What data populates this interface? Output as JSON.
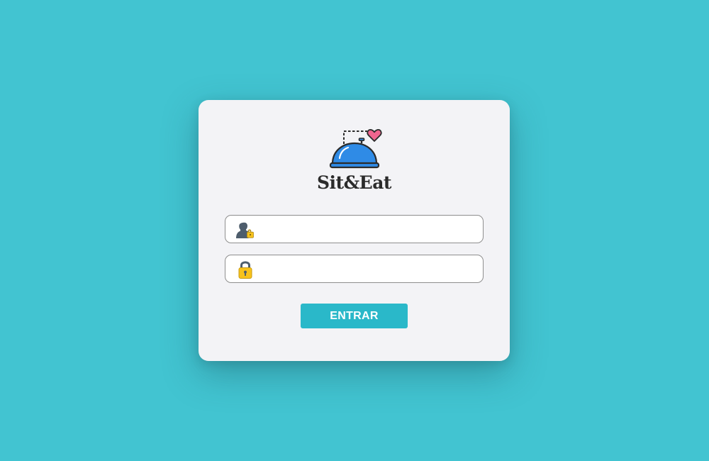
{
  "brand": {
    "name": "Sit&Eat",
    "logo_icon": "cloche-bell-heart-icon"
  },
  "login_form": {
    "username_field": {
      "icon": "user-lock-icon",
      "value": "",
      "placeholder": ""
    },
    "password_field": {
      "icon": "padlock-icon",
      "value": "",
      "placeholder": ""
    },
    "submit_label": "ENTRAR"
  },
  "colors": {
    "background": "#42c4d1",
    "card": "#f3f3f6",
    "button": "#2ab8c9",
    "cloche_blue": "#2f8be6",
    "heart_pink": "#f0658f",
    "lock_yellow": "#f7c21b"
  }
}
